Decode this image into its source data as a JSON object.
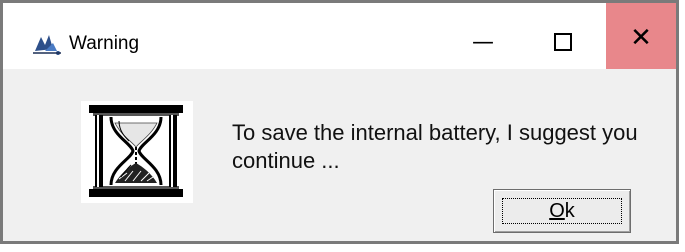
{
  "window": {
    "title": "Warning",
    "app_icon": "app-logo-icon",
    "controls": {
      "minimize": "—",
      "maximize_icon": "maximize-icon",
      "close": "✕"
    }
  },
  "dialog": {
    "icon": "hourglass-icon",
    "message": "To save the internal battery, I suggest you continue ...",
    "ok_button": {
      "accel": "O",
      "rest": "k"
    }
  },
  "colors": {
    "close_hover": "#e8878b",
    "titlebar": "#ffffff",
    "body": "#f0f0f0"
  }
}
